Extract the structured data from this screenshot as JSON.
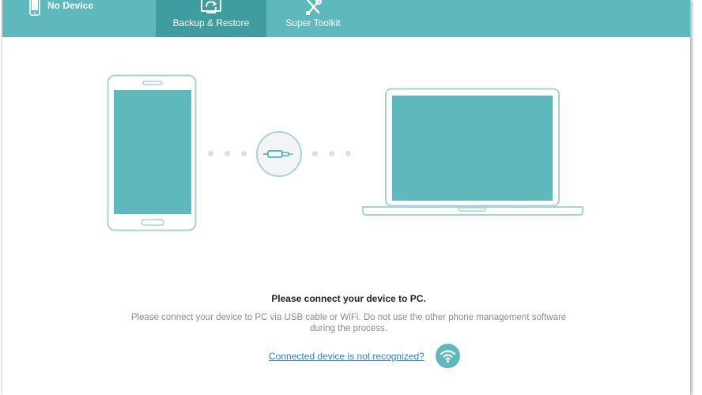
{
  "header": {
    "device_status": "No Device",
    "tabs": [
      {
        "label": "Backup & Restore",
        "icon": "backup-restore-icon",
        "active": true
      },
      {
        "label": "Super Toolkit",
        "icon": "toolkit-icon",
        "active": false
      }
    ]
  },
  "main": {
    "title": "Please connect your device to PC.",
    "description": "Please connect your device to PC via USB cable or WiFi. Do not use the other phone management software during the process.",
    "help_link": "Connected device is not recognized?"
  },
  "colors": {
    "accent": "#5fb8bb",
    "accent_dark": "#3f9c9f",
    "illustration_outline": "#9fcfd1",
    "link": "#2f7fc1"
  },
  "icons": [
    "phone-icon",
    "backup-restore-icon",
    "toolkit-icon",
    "usb-cable-icon",
    "wifi-icon"
  ]
}
